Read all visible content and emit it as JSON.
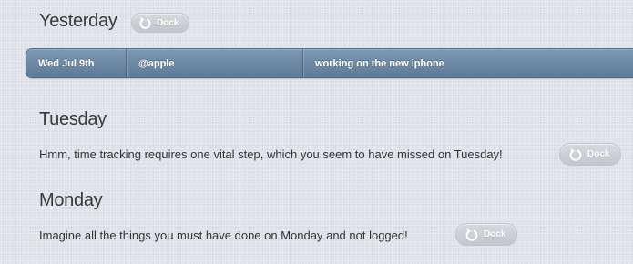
{
  "days": [
    {
      "heading": "Yesterday",
      "dock_label": "Dock",
      "entry": {
        "date": "Wed Jul 9th",
        "project": "@apple",
        "description": "working on the new iphone"
      }
    },
    {
      "heading": "Tuesday",
      "message": "Hmm, time tracking requires one vital step, which you seem to have missed on Tuesday!",
      "dock_label": "Dock"
    },
    {
      "heading": "Monday",
      "message": "Imagine all the things you must have done on Monday and not logged!",
      "dock_label": "Dock"
    }
  ],
  "icons": {
    "dock": "undo-arrow-icon"
  },
  "colors": {
    "background": "#dde1e8",
    "entry_bar": "#6b87a3",
    "dock_button": "#cdd0d5",
    "text": "#333333"
  }
}
